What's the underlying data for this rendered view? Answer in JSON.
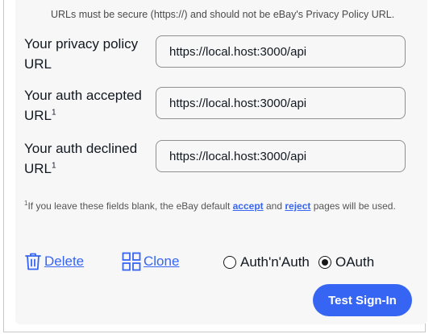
{
  "hint": "URLs must be secure (https://) and should not be eBay's Privacy Policy URL.",
  "fields": [
    {
      "label": "Your privacy policy URL",
      "value": "https://local.host:3000/api"
    },
    {
      "label": "Your auth accepted URL",
      "value": "https://local.host:3000/api"
    },
    {
      "label": "Your auth declined URL",
      "value": "https://local.host:3000/api"
    }
  ],
  "footnote": {
    "marker": "1",
    "before": "If you leave these fields blank, the eBay default ",
    "accept": "accept",
    "middle": " and ",
    "reject": "reject",
    "after": " pages will be used."
  },
  "actions": {
    "delete": "Delete",
    "clone": "Clone"
  },
  "auth_type": {
    "options": [
      "Auth'n'Auth",
      "OAuth"
    ],
    "selected": "OAuth"
  },
  "test_button": "Test Sign-In",
  "accent_color": "#3665f3"
}
